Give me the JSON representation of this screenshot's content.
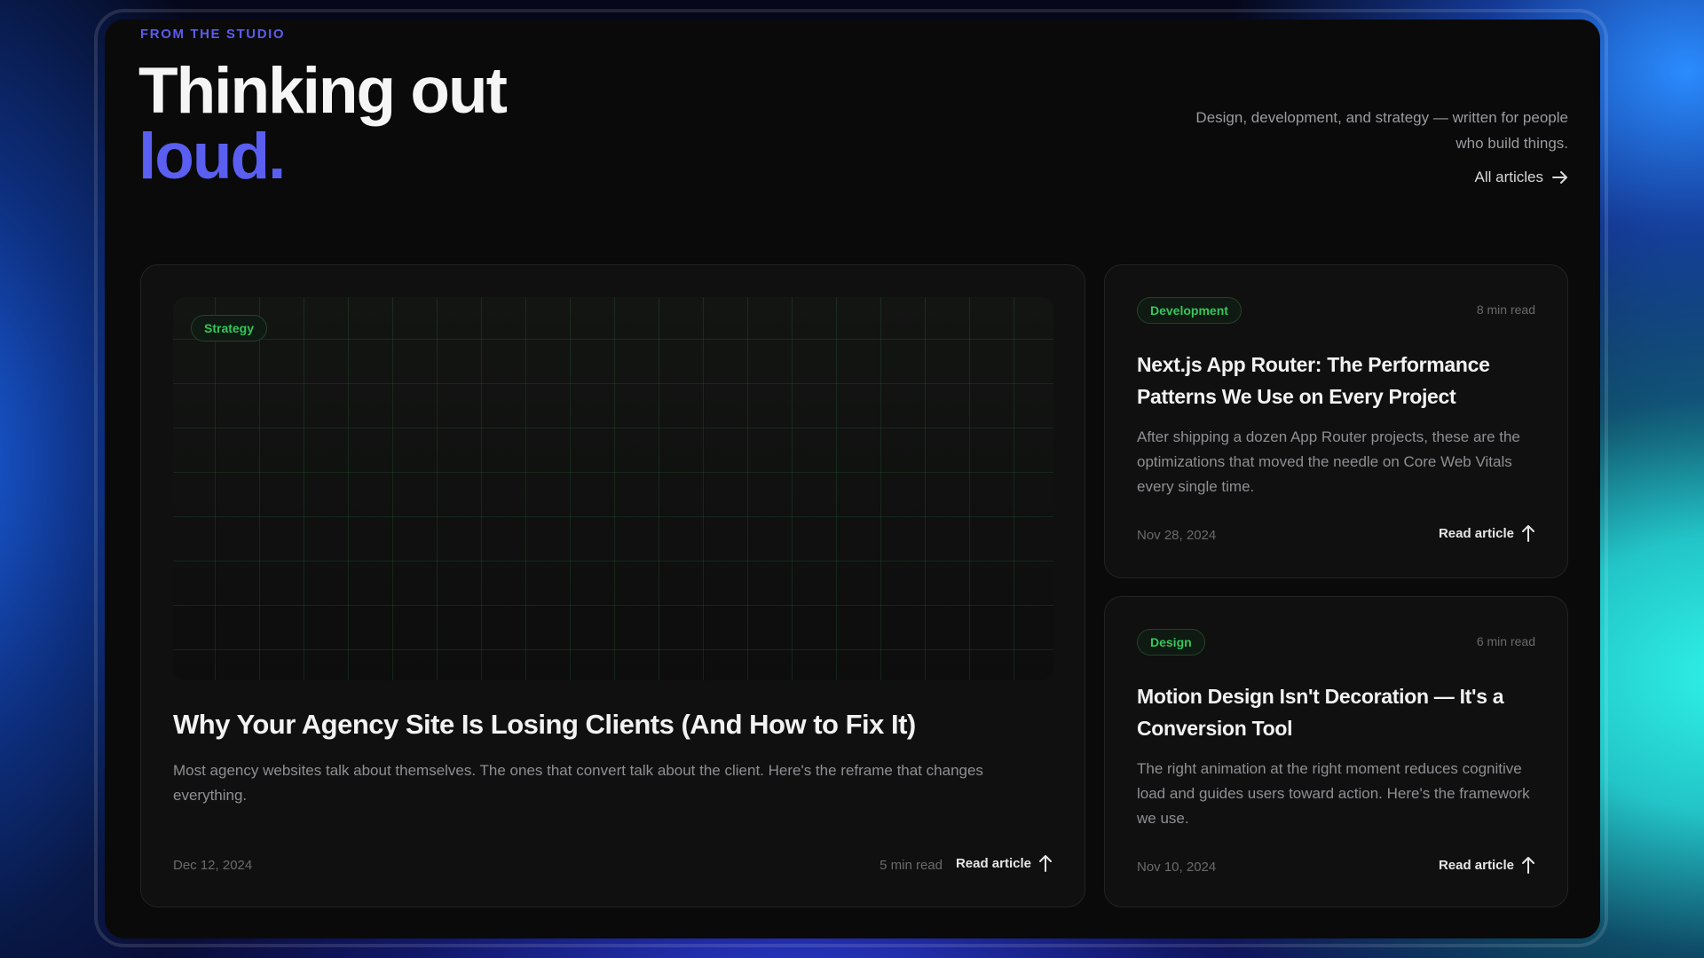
{
  "header": {
    "eyebrow": "FROM THE STUDIO",
    "title_line1": "Thinking out",
    "title_line2": "loud.",
    "intro": "Design, development, and strategy — written for people who build things.",
    "all_articles": "All articles",
    "accent_color": "#5a5ff2"
  },
  "featured": {
    "tag": "Strategy",
    "title": "Why Your Agency Site Is Losing Clients (And How to Fix It)",
    "excerpt": "Most agency websites talk about themselves. The ones that convert talk about the client. Here's the reframe that changes everything.",
    "date": "Dec 12, 2024",
    "read_time": "5 min read",
    "read_label": "Read article"
  },
  "articles": [
    {
      "tag": "Development",
      "read_time": "8 min read",
      "title": "Next.js App Router: The Performance Patterns We Use on Every Project",
      "excerpt": "After shipping a dozen App Router projects, these are the optimizations that moved the needle on Core Web Vitals every single time.",
      "date": "Nov 28, 2024",
      "read_label": "Read article"
    },
    {
      "tag": "Design",
      "read_time": "6 min read",
      "title": "Motion Design Isn't Decoration — It's a Conversion Tool",
      "excerpt": "The right animation at the right moment reduces cognitive load and guides users toward action. Here's the framework we use.",
      "date": "Nov 10, 2024",
      "read_label": "Read article"
    }
  ],
  "icons": {
    "all_articles": "arrow-right-icon",
    "read_article": "arrow-up-icon"
  },
  "colors": {
    "tag_green": "#34c759",
    "panel_bg": "#0a0a0a"
  }
}
